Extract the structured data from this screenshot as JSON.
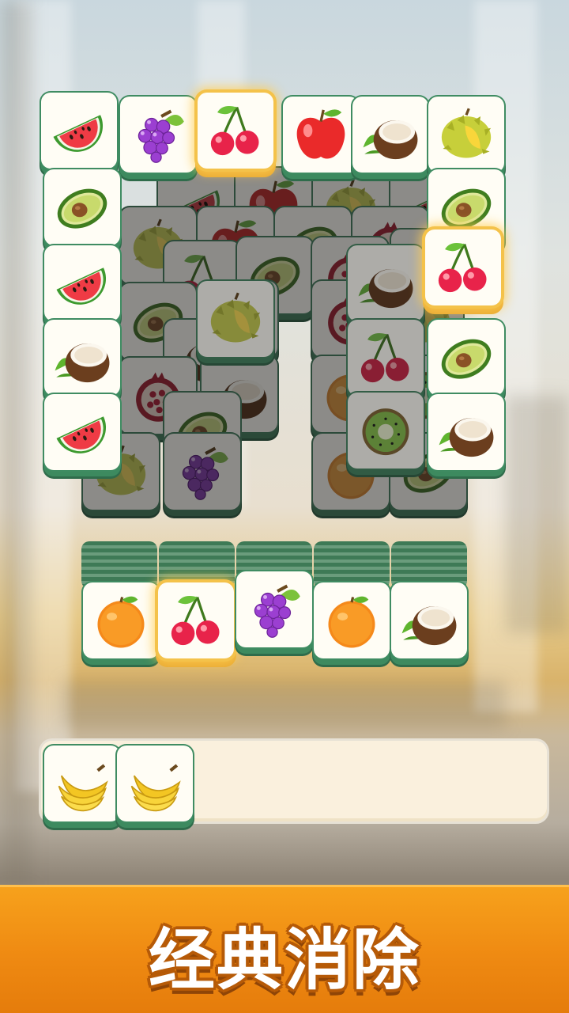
{
  "banner": {
    "title": "经典消除"
  },
  "tray": {
    "capacity": 7,
    "filled": 2
  },
  "icons": {
    "watermelon": "watermelon-icon",
    "grapes": "grapes-icon",
    "cherry": "cherry-icon",
    "apple": "apple-icon",
    "coconut": "coconut-icon",
    "durian": "durian-icon",
    "avocado": "avocado-icon",
    "orange": "orange-icon",
    "banana": "banana-icon",
    "kiwi": "kiwi-icon",
    "pomegranate": "pomegranate-icon"
  },
  "colors": {
    "tile_border": "#3f8c62",
    "highlight": "#f4c24a",
    "banner": "#ef8a12"
  }
}
